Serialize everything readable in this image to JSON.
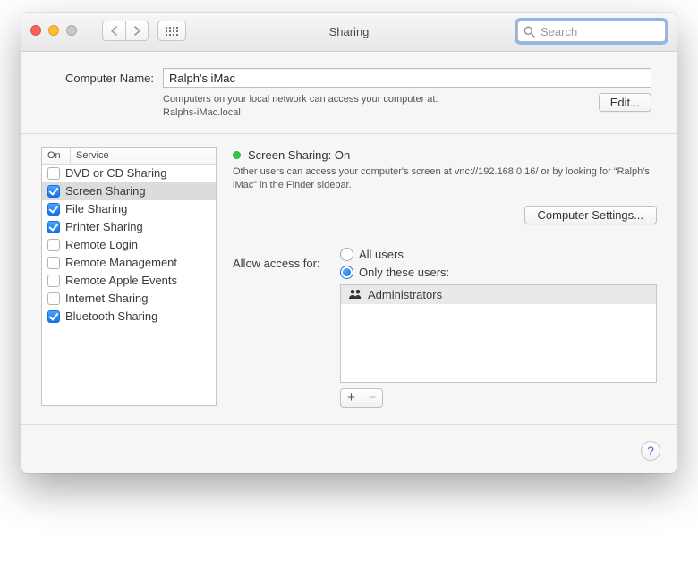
{
  "window": {
    "title": "Sharing"
  },
  "search": {
    "placeholder": "Search"
  },
  "computer_name": {
    "label": "Computer Name:",
    "value": "Ralph's iMac",
    "hint_line1": "Computers on your local network can access your computer at:",
    "hint_line2": "Ralphs-iMac.local",
    "edit_button": "Edit..."
  },
  "services": {
    "header_on": "On",
    "header_service": "Service",
    "items": [
      {
        "label": "DVD or CD Sharing",
        "checked": false,
        "selected": false
      },
      {
        "label": "Screen Sharing",
        "checked": true,
        "selected": true
      },
      {
        "label": "File Sharing",
        "checked": true,
        "selected": false
      },
      {
        "label": "Printer Sharing",
        "checked": true,
        "selected": false
      },
      {
        "label": "Remote Login",
        "checked": false,
        "selected": false
      },
      {
        "label": "Remote Management",
        "checked": false,
        "selected": false
      },
      {
        "label": "Remote Apple Events",
        "checked": false,
        "selected": false
      },
      {
        "label": "Internet Sharing",
        "checked": false,
        "selected": false
      },
      {
        "label": "Bluetooth Sharing",
        "checked": true,
        "selected": false
      }
    ]
  },
  "detail": {
    "status_title": "Screen Sharing: On",
    "status_color": "#33c748",
    "status_desc": "Other users can access your computer's screen at vnc://192.168.0.16/ or by looking for “Ralph's iMac” in the Finder sidebar.",
    "computer_settings_button": "Computer Settings...",
    "access_label": "Allow access for:",
    "option_all": "All users",
    "option_only": "Only these users:",
    "selected_option": "only",
    "users": [
      {
        "label": "Administrators"
      }
    ],
    "add_label": "+",
    "remove_label": "−"
  },
  "help": {
    "label": "?"
  }
}
